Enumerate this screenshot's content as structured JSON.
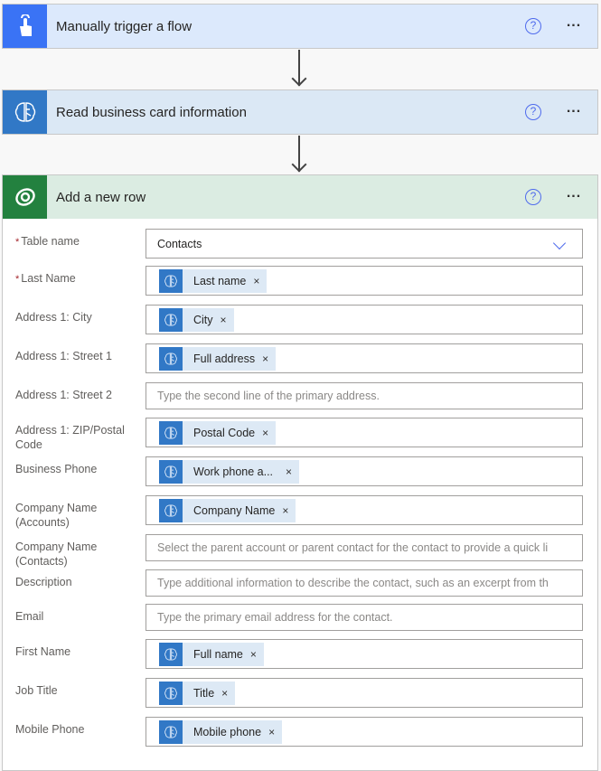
{
  "cards": {
    "trigger": {
      "title": "Manually trigger a flow",
      "icon": "touch-hand-icon",
      "help": "?",
      "more": "..."
    },
    "read": {
      "title": "Read business card information",
      "icon": "ai-builder-brain-icon",
      "help": "?",
      "more": "..."
    },
    "add": {
      "title": "Add a new row",
      "icon": "dataverse-icon",
      "help": "?",
      "more": "..."
    }
  },
  "colors": {
    "trigger_accent": "#3a73f5",
    "ai_builder_accent": "#3178c6",
    "dataverse_accent": "#23813f",
    "link_blue": "#4f6bed",
    "required_red": "#a4262c"
  },
  "form": {
    "fields": [
      {
        "label": "Table name",
        "required": true,
        "type": "dropdown",
        "value": "Contacts"
      },
      {
        "label": "Last Name",
        "required": true,
        "type": "token",
        "token": "Last name"
      },
      {
        "label": "Address 1: City",
        "required": false,
        "type": "token",
        "token": "City"
      },
      {
        "label": "Address 1: Street 1",
        "required": false,
        "type": "token",
        "token": "Full address"
      },
      {
        "label": "Address 1: Street 2",
        "required": false,
        "type": "text",
        "placeholder": "Type the second line of the primary address."
      },
      {
        "label": "Address 1: ZIP/Postal Code",
        "required": false,
        "type": "token",
        "token": "Postal Code"
      },
      {
        "label": "Business Phone",
        "required": false,
        "type": "token",
        "token": "Work phone a..."
      },
      {
        "label": "Company Name (Accounts)",
        "required": false,
        "type": "token",
        "token": "Company Name"
      },
      {
        "label": "Company Name (Contacts)",
        "required": false,
        "type": "text",
        "placeholder": "Select the parent account or parent contact for the contact to provide a quick li"
      },
      {
        "label": "Description",
        "required": false,
        "type": "text",
        "placeholder": "Type additional information to describe the contact, such as an excerpt from th"
      },
      {
        "label": "Email",
        "required": false,
        "type": "text",
        "placeholder": "Type the primary email address for the contact."
      },
      {
        "label": "First Name",
        "required": false,
        "type": "token",
        "token": "Full name"
      },
      {
        "label": "Job Title",
        "required": false,
        "type": "token",
        "token": "Title"
      },
      {
        "label": "Mobile Phone",
        "required": false,
        "type": "token",
        "token": "Mobile phone"
      }
    ],
    "required_marker": "*",
    "token_close": "×"
  }
}
